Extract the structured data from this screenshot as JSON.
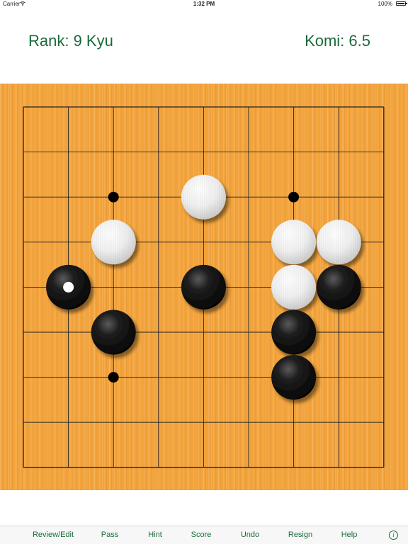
{
  "status_bar": {
    "carrier": "Carrier",
    "time": "1:32 PM",
    "battery": "100%"
  },
  "header": {
    "rank": "Rank: 9 Kyu",
    "komi": "Komi: 6.5"
  },
  "board": {
    "size": 9,
    "star_points": [
      [
        2,
        2
      ],
      [
        6,
        2
      ],
      [
        2,
        6
      ]
    ],
    "stones": [
      {
        "color": "white",
        "col": 4,
        "row": 2
      },
      {
        "color": "white",
        "col": 2,
        "row": 3
      },
      {
        "color": "white",
        "col": 6,
        "row": 3
      },
      {
        "color": "white",
        "col": 7,
        "row": 3
      },
      {
        "color": "black",
        "col": 1,
        "row": 4,
        "last_move": true
      },
      {
        "color": "black",
        "col": 4,
        "row": 4
      },
      {
        "color": "white",
        "col": 6,
        "row": 4
      },
      {
        "color": "black",
        "col": 7,
        "row": 4
      },
      {
        "color": "black",
        "col": 2,
        "row": 5
      },
      {
        "color": "black",
        "col": 6,
        "row": 5
      },
      {
        "color": "black",
        "col": 6,
        "row": 6
      }
    ]
  },
  "toolbar": {
    "review_edit": "Review/Edit",
    "pass": "Pass",
    "hint": "Hint",
    "score": "Score",
    "undo": "Undo",
    "resign": "Resign",
    "help": "Help",
    "info_icon": "i",
    "info_icon_name": "info-icon"
  },
  "colors": {
    "accent": "#1a6b3a",
    "board": "#f2a33c"
  }
}
